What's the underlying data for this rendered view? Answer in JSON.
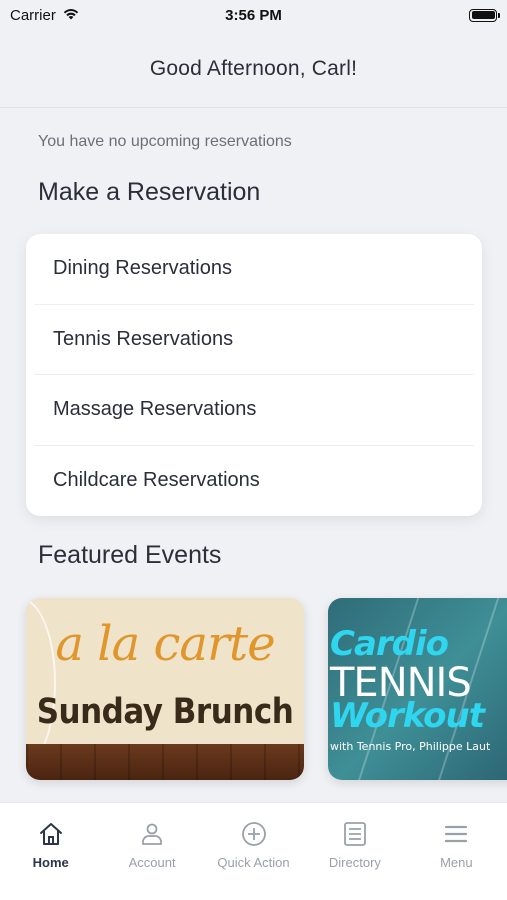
{
  "status_bar": {
    "carrier": "Carrier",
    "time": "3:56 PM"
  },
  "header": {
    "greeting": "Good Afternoon, Carl!"
  },
  "reservations": {
    "empty_message": "You have no upcoming reservations",
    "section_title": "Make a Reservation",
    "items": [
      {
        "label": "Dining Reservations"
      },
      {
        "label": "Tennis Reservations"
      },
      {
        "label": "Massage Reservations"
      },
      {
        "label": "Childcare Reservations"
      }
    ]
  },
  "featured": {
    "section_title": "Featured Events",
    "events": [
      {
        "script_title": "a la carte",
        "subtitle": "Sunday Brunch"
      },
      {
        "line1": "Cardio",
        "line2": "TENNIS",
        "line3": "Workout",
        "caption": "with Tennis Pro, Philippe Laut"
      }
    ]
  },
  "tabbar": {
    "tabs": [
      {
        "label": "Home",
        "icon": "home-icon",
        "active": true
      },
      {
        "label": "Account",
        "icon": "person-icon",
        "active": false
      },
      {
        "label": "Quick Action",
        "icon": "plus-circle-icon",
        "active": false
      },
      {
        "label": "Directory",
        "icon": "list-icon",
        "active": false
      },
      {
        "label": "Menu",
        "icon": "hamburger-icon",
        "active": false
      }
    ]
  },
  "colors": {
    "background": "#f0f1f5",
    "text": "#2b2f3a",
    "tab_active": "#2b3648",
    "tab_inactive": "#9aa0aa"
  }
}
